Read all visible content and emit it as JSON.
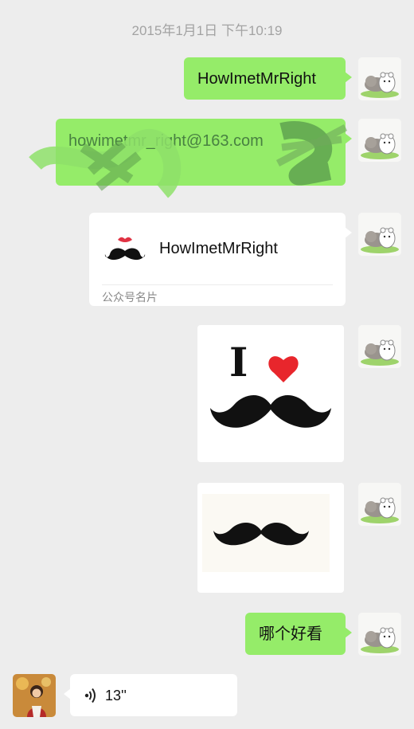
{
  "chat": {
    "timestamp": "2015年1月1日 下午10:19",
    "messages": [
      {
        "type": "text",
        "text": "HowImetMrRight"
      },
      {
        "type": "text",
        "text": "howimetmr_right@163.com",
        "note_redacted": true
      },
      {
        "type": "card",
        "title": "HowImetMrRight",
        "subtitle": "公众号名片",
        "logo_icon": "mustache-lips-icon"
      },
      {
        "type": "image",
        "image_icon": "i-love-mustache-image",
        "heading": "I"
      },
      {
        "type": "image",
        "image_icon": "mustache-image"
      },
      {
        "type": "text",
        "text": "哪个好看"
      },
      {
        "type": "voice",
        "duration": "13''",
        "voice_icon": "voice-wave-icon"
      }
    ]
  },
  "colors": {
    "background": "#ededed",
    "sent_bubble": "#95ec69",
    "received_bubble": "#ffffff",
    "timestamp": "#a3a3a3",
    "heart": "#e8262c"
  }
}
